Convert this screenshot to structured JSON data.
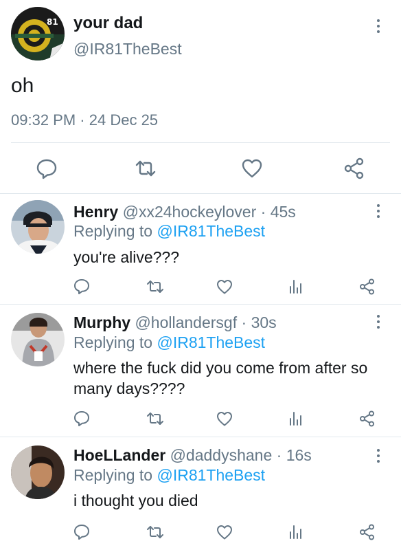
{
  "main_tweet": {
    "display_name": "your dad",
    "handle": "@IR81TheBest",
    "text": "oh",
    "time": "09:32 PM",
    "dot": "·",
    "date": "24 Dec 25"
  },
  "replies": [
    {
      "name": "Henry",
      "handle": "@xx24hockeylover",
      "dot": "·",
      "time": "45s",
      "replying_to_label": "Replying to",
      "replying_to_handle": "@IR81TheBest",
      "text": "you're alive???"
    },
    {
      "name": "Murphy",
      "handle": "@hollandersgf",
      "dot": "·",
      "time": "30s",
      "replying_to_label": "Replying to",
      "replying_to_handle": "@IR81TheBest",
      "text": "where the fuck did you come from after so many days????"
    },
    {
      "name": "HoeLLander",
      "handle": "@daddyshane",
      "dot": "·",
      "time": "16s",
      "replying_to_label": "Replying to",
      "replying_to_handle": "@IR81TheBest",
      "text": "i thought you died"
    }
  ],
  "colors": {
    "primary_text": "#14171a",
    "secondary_text": "#657786",
    "link": "#1da1f2",
    "divider": "#e1e8ed"
  },
  "icons": {
    "reply": "reply-icon",
    "retweet": "retweet-icon",
    "like": "like-icon",
    "analytics": "analytics-icon",
    "share": "share-icon",
    "more": "more-icon"
  }
}
